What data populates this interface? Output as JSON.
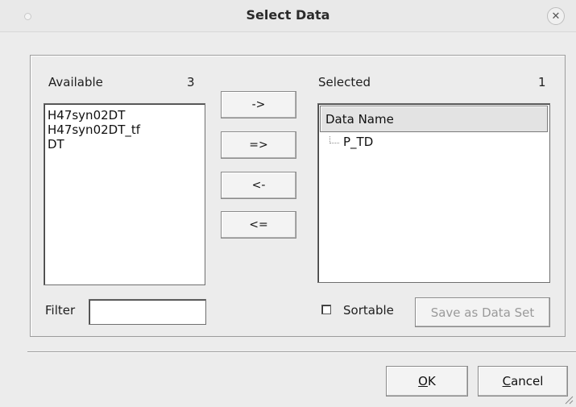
{
  "window": {
    "title": "Select Data"
  },
  "available": {
    "label": "Available",
    "count": "3",
    "items": [
      "H47syn02DT",
      "H47syn02DT_tf",
      "DT"
    ]
  },
  "selected": {
    "label": "Selected",
    "count": "1",
    "column_header": "Data Name",
    "items": [
      "P_TD"
    ]
  },
  "transfer_buttons": {
    "add_one": "->",
    "add_all": "=>",
    "remove_one": "<-",
    "remove_all": "<="
  },
  "filter": {
    "label": "Filter",
    "value": ""
  },
  "sortable": {
    "label": "Sortable",
    "checked": false
  },
  "save_as_data_set": {
    "label": "Save as Data Set",
    "enabled": false
  },
  "ok_button": {
    "mnemonic": "O",
    "rest": "K"
  },
  "cancel_button": {
    "mnemonic": "C",
    "rest": "ancel"
  }
}
